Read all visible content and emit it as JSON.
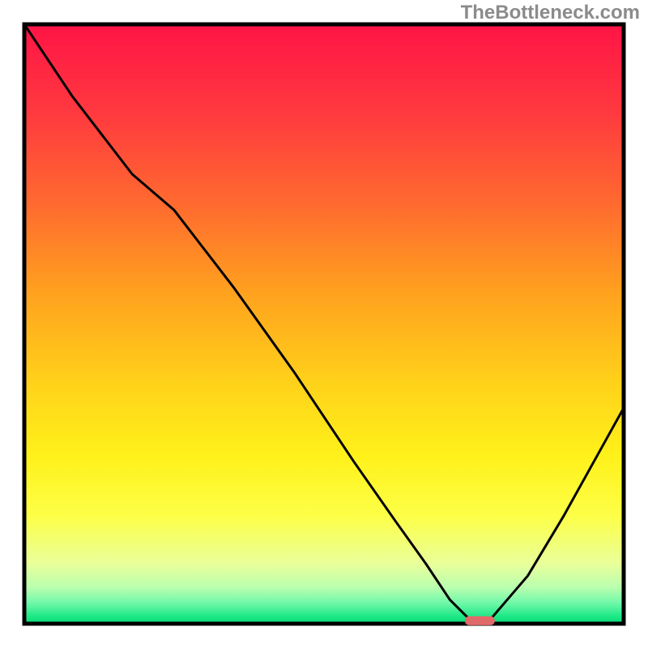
{
  "watermark": "TheBottleneck.com",
  "chart_data": {
    "type": "line",
    "title": "",
    "xlabel": "",
    "ylabel": "",
    "xlim": [
      0,
      100
    ],
    "ylim": [
      0,
      100
    ],
    "background": {
      "type": "vertical-gradient",
      "stops": [
        {
          "offset": 0.0,
          "color": "#ff1446"
        },
        {
          "offset": 0.15,
          "color": "#ff3a3f"
        },
        {
          "offset": 0.3,
          "color": "#ff6a2f"
        },
        {
          "offset": 0.45,
          "color": "#ffa21e"
        },
        {
          "offset": 0.6,
          "color": "#ffd21a"
        },
        {
          "offset": 0.72,
          "color": "#fff11a"
        },
        {
          "offset": 0.82,
          "color": "#fdff47"
        },
        {
          "offset": 0.9,
          "color": "#e9ff9a"
        },
        {
          "offset": 0.94,
          "color": "#b9ffb0"
        },
        {
          "offset": 0.965,
          "color": "#71f8a9"
        },
        {
          "offset": 0.99,
          "color": "#16e783"
        },
        {
          "offset": 1.0,
          "color": "#09d978"
        }
      ]
    },
    "series": [
      {
        "name": "bottleneck-curve",
        "color": "#000000",
        "x": [
          0,
          8,
          18,
          25,
          35,
          45,
          55,
          62,
          67,
          71,
          74,
          78,
          84,
          90,
          95,
          100
        ],
        "y": [
          100,
          88,
          75,
          69,
          56,
          42,
          27,
          17,
          10,
          4,
          1,
          1,
          8,
          18,
          27,
          36
        ]
      }
    ],
    "marker": {
      "name": "optimal-marker",
      "x": 76,
      "y": 0.5,
      "width": 5,
      "height": 1.5,
      "color": "#e06a6a"
    },
    "frame_color": "#000000"
  }
}
